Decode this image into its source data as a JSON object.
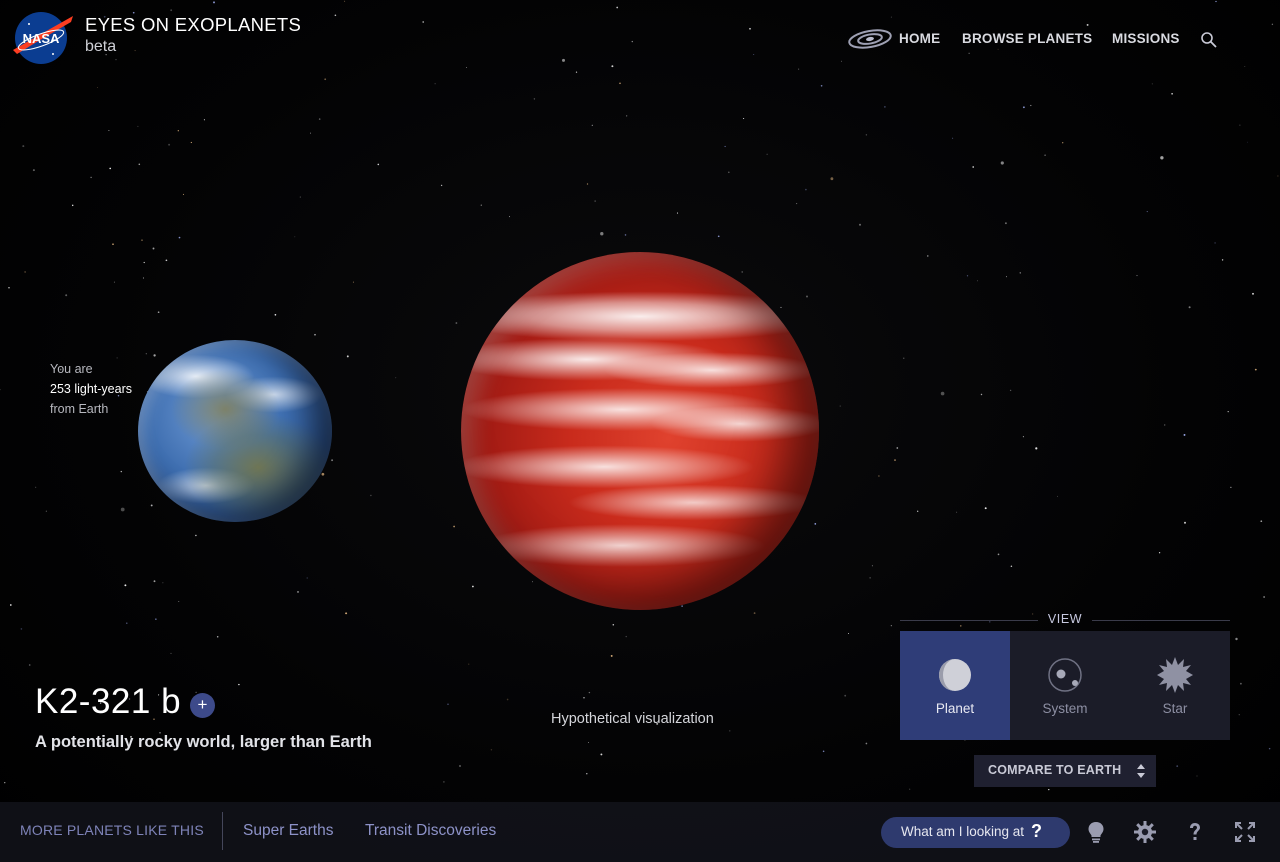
{
  "header": {
    "logo_text": "NASA",
    "site_title": "EYES ON EXOPLANETS",
    "site_subtitle": "beta",
    "nav": {
      "galaxy_icon": "galaxy-icon",
      "home": "HOME",
      "browse": "BROWSE PLANETS",
      "missions": "MISSIONS",
      "search_icon": "search-icon"
    }
  },
  "scene": {
    "distance": {
      "prefix": "You are",
      "value": "253 light-years",
      "suffix": "from Earth"
    },
    "caption": "Hypothetical visualization"
  },
  "planet": {
    "name": "K2-321 b",
    "add_label": "+",
    "tagline": "A potentially rocky world, larger than Earth"
  },
  "view_panel": {
    "heading": "VIEW",
    "options": [
      {
        "label": "Planet",
        "icon": "planet-icon",
        "active": true
      },
      {
        "label": "System",
        "icon": "system-icon",
        "active": false
      },
      {
        "label": "Star",
        "icon": "star-icon",
        "active": false
      }
    ],
    "compare_label": "COMPARE TO EARTH"
  },
  "bottom_bar": {
    "more_label": "MORE PLANETS LIKE THIS",
    "categories": [
      "Super Earths",
      "Transit Discoveries"
    ],
    "help_label": "What am I looking at",
    "help_mark": "?",
    "icons": [
      "lightbulb-icon",
      "gear-icon",
      "help-icon",
      "fullscreen-icon"
    ]
  },
  "colors": {
    "accent": "#2f3d78",
    "link": "#8d92c8",
    "panel": "#1b1c28",
    "exoplanet_red": "#c92b1c"
  }
}
